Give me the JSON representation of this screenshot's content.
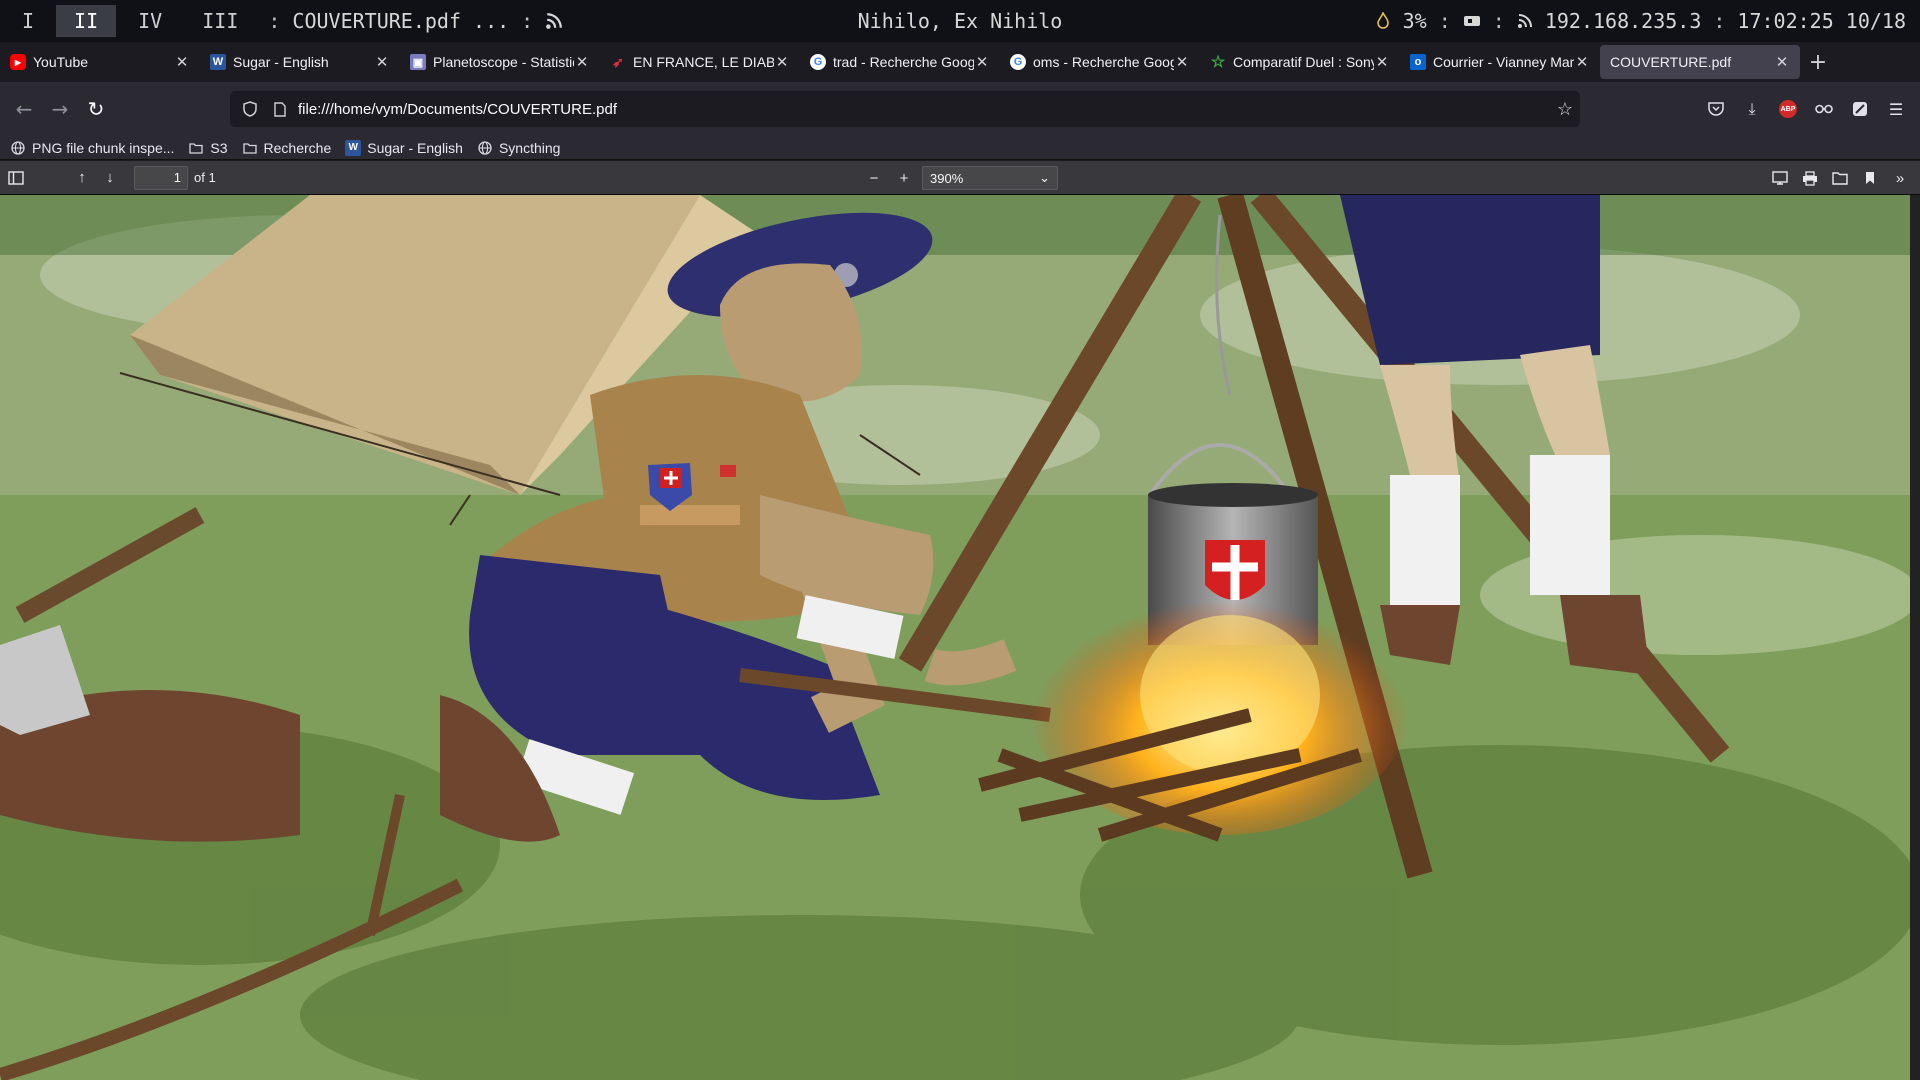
{
  "sysbar": {
    "workspaces": [
      "I",
      "II",
      "IV",
      "III"
    ],
    "active_workspace": "II",
    "window_title": "COUVERTURE.pdf ...",
    "center_title": "Nihilo, Ex Nihilo",
    "cpu": "3%",
    "ip": "192.168.235.3",
    "time": "17:02:25 10/18",
    "sep": ":"
  },
  "tabs": [
    {
      "title": "YouTube",
      "icon": "youtube-icon",
      "color": "#ff0000",
      "glyph": "▶"
    },
    {
      "title": "Sugar - English",
      "icon": "word-icon",
      "color": "#2b579a",
      "glyph": "W"
    },
    {
      "title": "Planetoscope - Statistiqu",
      "icon": "planetoscope-icon",
      "color": "#6a6ab0",
      "glyph": "▣"
    },
    {
      "title": "EN FRANCE, LE DIABETE",
      "icon": "bird-icon",
      "color": "#d02030",
      "glyph": "➶"
    },
    {
      "title": "trad - Recherche Google",
      "icon": "google-icon",
      "color": "#ffffff",
      "glyph": "G"
    },
    {
      "title": "oms - Recherche Google",
      "icon": "google-icon",
      "color": "#ffffff",
      "glyph": "G"
    },
    {
      "title": "Comparatif Duel : Sony",
      "icon": "star-icon",
      "color": "#3cb043",
      "glyph": "☆"
    },
    {
      "title": "Courrier - Vianney Marti",
      "icon": "outlook-icon",
      "color": "#0a64d0",
      "glyph": "o"
    },
    {
      "title": "COUVERTURE.pdf",
      "icon": "",
      "color": "",
      "glyph": ""
    }
  ],
  "nav": {
    "url": "file:///home/vym/Documents/COUVERTURE.pdf",
    "abp_label": "ABP"
  },
  "bookmarks": [
    {
      "label": "PNG file chunk inspe...",
      "icon": "globe-icon"
    },
    {
      "label": "S3",
      "icon": "folder-icon"
    },
    {
      "label": "Recherche",
      "icon": "folder-icon"
    },
    {
      "label": "Sugar - English",
      "icon": "word-icon"
    },
    {
      "label": "Syncthing",
      "icon": "globe-icon"
    }
  ],
  "pdf": {
    "page": "1",
    "of_pages": "of 1",
    "zoom": "390%"
  }
}
